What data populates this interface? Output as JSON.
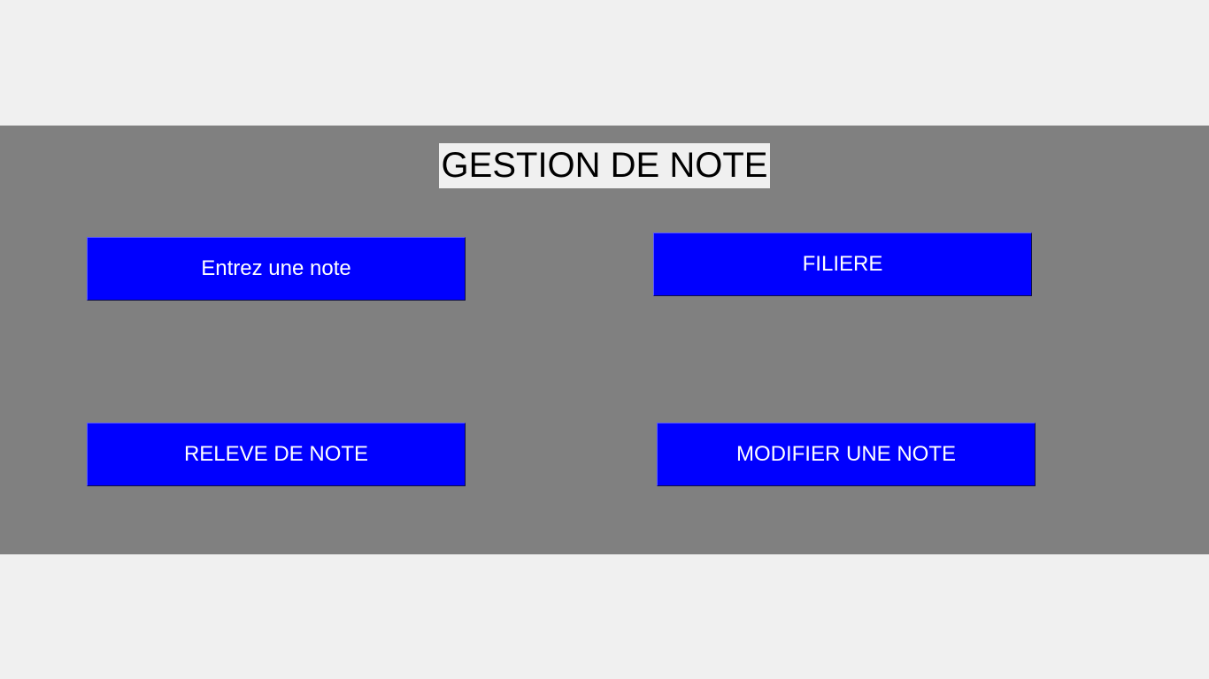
{
  "title": "GESTION DE NOTE",
  "buttons": {
    "enter_note": "Entrez une note",
    "filiere": "FILIERE",
    "releve": "RELEVE DE NOTE",
    "modify": "MODIFIER UNE NOTE"
  },
  "colors": {
    "background": "#f0f0f0",
    "panel": "#808080",
    "button": "#0000ff",
    "button_text": "#ffffff",
    "title_text": "#000000"
  }
}
